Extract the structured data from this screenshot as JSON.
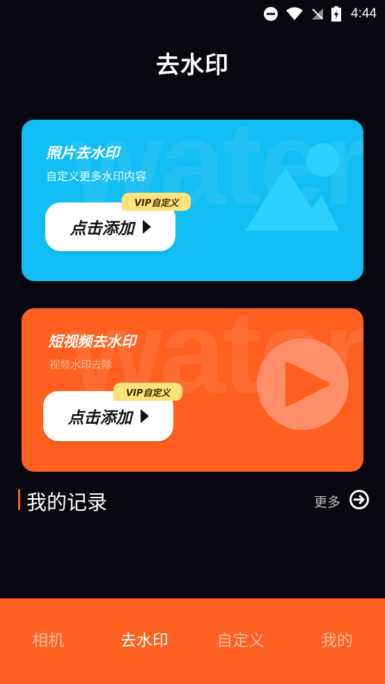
{
  "status": {
    "time": "4:44"
  },
  "header": {
    "title": "去水印"
  },
  "cards": [
    {
      "title": "照片去水印",
      "subtitle": "自定义更多水印内容",
      "button_label": "点击添加",
      "badge": "VIP自定义",
      "watermark": "water",
      "color": "#11bdf2",
      "icon": "mountain-image-icon"
    },
    {
      "title": "短视频去水印",
      "subtitle": "视频水印去除",
      "button_label": "点击添加",
      "badge": "VIP自定义",
      "watermark": "water",
      "color": "#ff5f1f",
      "icon": "play-circle-icon"
    }
  ],
  "records": {
    "title": "我的记录",
    "more_label": "更多"
  },
  "nav": {
    "items": [
      {
        "label": "相机"
      },
      {
        "label": "去水印",
        "active": true
      },
      {
        "label": "自定义"
      },
      {
        "label": "我的"
      }
    ]
  },
  "colors": {
    "accent": "#ff5f1f",
    "photo_card": "#11bdf2",
    "vip": "#ffe27a",
    "background": "#08060f"
  }
}
